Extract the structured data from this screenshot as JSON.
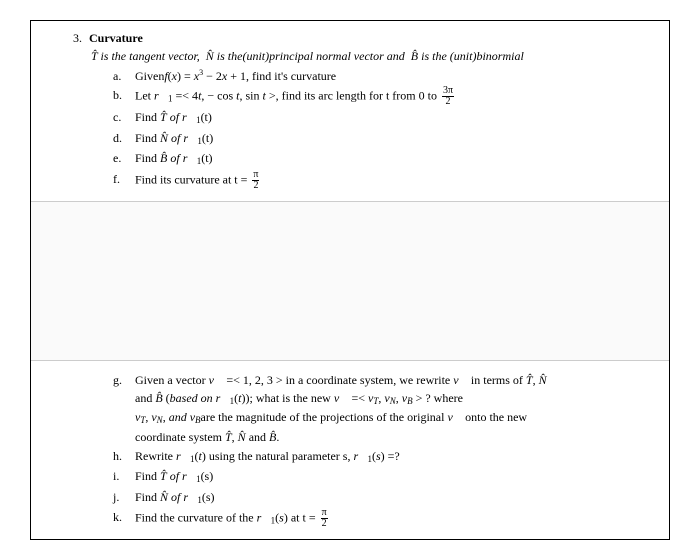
{
  "question": {
    "number": "3.",
    "title": "Curvature",
    "intro": "T̂ is the tangent vector,  N̂ is the(unit)principal normal vector and  B̂ is the (unit)binormial",
    "items_top": [
      {
        "label": "a.",
        "text": "Givenf(x) = x³ − 2x + 1, find it's curvature"
      },
      {
        "label": "b.",
        "text": "Let r⃗₁ =< 4t, − cos t, sin t >, find its arc length for t from 0 to 3π/2"
      },
      {
        "label": "c.",
        "text": "Find T̂ of r⃗₁(t)"
      },
      {
        "label": "d.",
        "text": "Find N̂ of r⃗₁(t)"
      },
      {
        "label": "e.",
        "text": "Find B̂ of r⃗₁(t)"
      },
      {
        "label": "f.",
        "text": "Find its curvature at t = π/2"
      }
    ],
    "items_bottom": [
      {
        "label": "g.",
        "text": "Given a vector v⃗ =< 1, 2, 3 > in a coordinate system, we rewrite v⃗ in terms of T̂, N̂ and B̂ (based on r⃗₁(t)); what is the new v⃗ =< v_T, v_N, v_B > ? where v_T, v_N, and v_B are the magnitude of the projections of the original v⃗ onto the new coordinate system T̂, N̂ and B̂."
      },
      {
        "label": "h.",
        "text": "Rewrite r⃗₁(t) using the natural parameter s, r⃗₁(s) =?"
      },
      {
        "label": "i.",
        "text": "Find T̂ of r⃗₁(s)"
      },
      {
        "label": "j.",
        "text": "Find N̂ of r⃗₁(s)"
      },
      {
        "label": "k.",
        "text": "Find the curvature of the r⃗₁(s) at t = π/2"
      }
    ]
  }
}
